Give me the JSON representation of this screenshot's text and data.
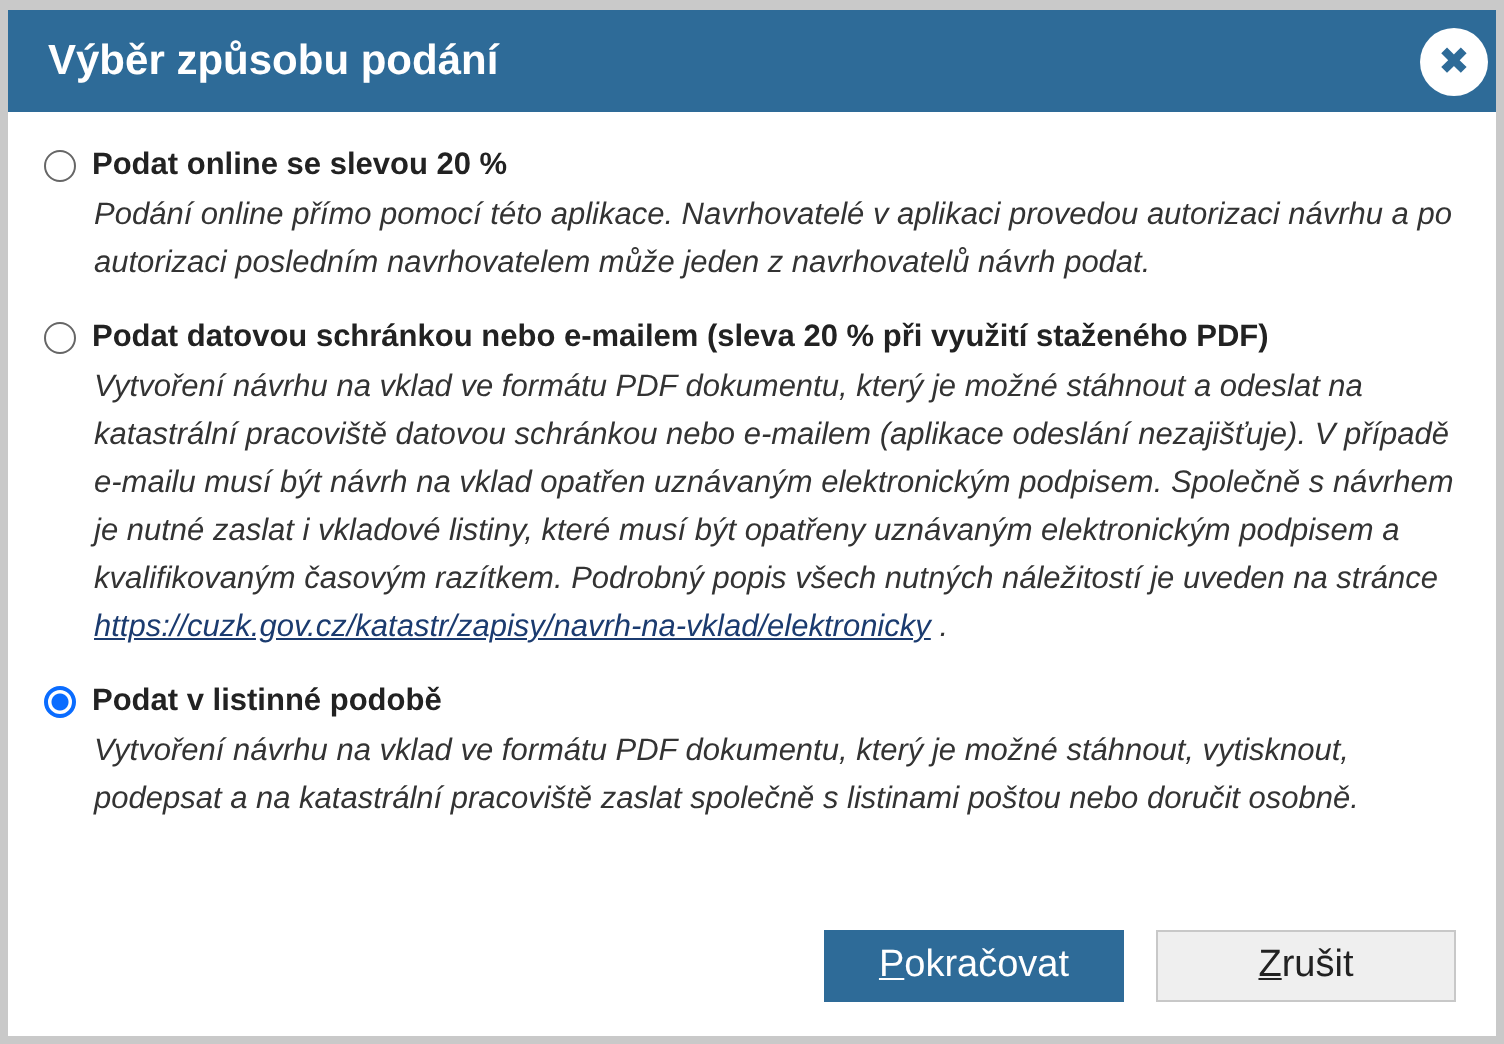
{
  "dialog": {
    "title": "Výběr způsobu podání",
    "close_label": "✖"
  },
  "options": [
    {
      "label": "Podat online se slevou 20 %",
      "selected": false,
      "description": "Podání online přímo pomocí této aplikace. Navrhovatelé v aplikaci provedou autorizaci návrhu a po autorizaci posledním navrhovatelem může jeden z navrhovatelů návrh podat."
    },
    {
      "label": "Podat datovou schránkou nebo e-mailem (sleva 20 % při využití staženého PDF)",
      "selected": false,
      "description": "Vytvoření návrhu na vklad ve formátu PDF dokumentu, který je možné stáhnout a odeslat na katastrální pracoviště datovou schránkou nebo e-mailem (aplikace odeslání nezajišťuje). V případě e-mailu musí být návrh na vklad opatřen uznávaným elektronickým podpisem. Společně s návrhem je nutné zaslat i vkladové listiny, které musí být opatřeny uznávaným elektronickým podpisem a kvalifikovaným časovým razítkem. Podrobný popis všech nutných náležitostí je uveden na stránce",
      "link": "https://cuzk.gov.cz/katastr/zapisy/navrh-na-vklad/elektronicky",
      "after": " ."
    },
    {
      "label": "Podat v listinné podobě",
      "selected": true,
      "description": "Vytvoření návrhu na vklad ve formátu PDF dokumentu, který je možné stáhnout, vytisknout, podepsat a na katastrální pracoviště zaslat společně s listinami poštou nebo doručit osobně."
    }
  ],
  "buttons": [
    {
      "label": "Pokračovat",
      "kind": "primary"
    },
    {
      "label": "Zrušit",
      "kind": "secondary"
    }
  ]
}
